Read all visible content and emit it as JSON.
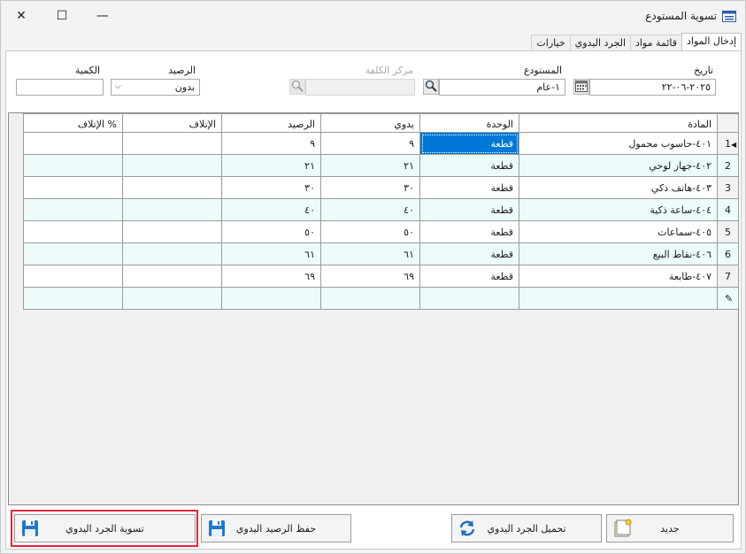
{
  "window": {
    "title": "تسوية المستودع",
    "minimize_glyph": "—",
    "maximize_glyph": "☐",
    "close_glyph": "✕"
  },
  "tabs": [
    {
      "label": "إدخال المواد",
      "active": true
    },
    {
      "label": "قائمة مواد",
      "active": false
    },
    {
      "label": "الجرد اليدوي",
      "active": false
    },
    {
      "label": "خيارات",
      "active": false
    }
  ],
  "form": {
    "date_label": "تاريخ",
    "date_value": "٢٠٢٥-٠٦-٢٢",
    "warehouse_label": "المستودع",
    "warehouse_value": "١-عام",
    "cost_center_label": "مركز الكلفة",
    "cost_center_value": "",
    "balance_label": "الرصيد",
    "balance_value": "بدون",
    "quantity_label": "الكمية",
    "quantity_value": ""
  },
  "grid": {
    "columns": [
      "المادة",
      "الوحدة",
      "يدوي",
      "الرصيد",
      "الإتلاف",
      "الإتلاف %"
    ],
    "rows": [
      {
        "num": "1",
        "item": "٤٠١-حاسوب محمول",
        "unit": "قطعة",
        "manual": "٩",
        "balance": "٩",
        "damage": "",
        "damage_pct": ""
      },
      {
        "num": "2",
        "item": "٤٠٢-جهاز لوحي",
        "unit": "قطعة",
        "manual": "٢١",
        "balance": "٢١",
        "damage": "",
        "damage_pct": ""
      },
      {
        "num": "3",
        "item": "٤٠٣-هاتف ذكي",
        "unit": "قطعة",
        "manual": "٣٠",
        "balance": "٣٠",
        "damage": "",
        "damage_pct": ""
      },
      {
        "num": "4",
        "item": "٤٠٤-ساعة ذكية",
        "unit": "قطعة",
        "manual": "٤٠",
        "balance": "٤٠",
        "damage": "",
        "damage_pct": ""
      },
      {
        "num": "5",
        "item": "٤٠٥-سماعات",
        "unit": "قطعة",
        "manual": "٥٠",
        "balance": "٥٠",
        "damage": "",
        "damage_pct": ""
      },
      {
        "num": "6",
        "item": "٤٠٦-نقاط البيع",
        "unit": "قطعة",
        "manual": "٦١",
        "balance": "٦١",
        "damage": "",
        "damage_pct": ""
      },
      {
        "num": "7",
        "item": "٤٠٧-طابعة",
        "unit": "قطعة",
        "manual": "٦٩",
        "balance": "٦٩",
        "damage": "",
        "damage_pct": ""
      }
    ],
    "new_row_marker": "✎"
  },
  "buttons": {
    "new": "جديد",
    "load_manual": "تحميل الجرد اليدوي",
    "save_balance": "حفظ الرصيد اليدوي",
    "settle_manual": "تسوية الجرد اليدوي"
  },
  "icons": {
    "title": "window-form-icon",
    "calendar": "calendar-icon",
    "search": "magnifier-icon",
    "new": "new-document-icon",
    "load": "refresh-arrows-icon",
    "save": "floppy-disk-icon"
  },
  "colors": {
    "selection": "#0078d7",
    "alt_row": "#ecfcfb",
    "highlight": "#e2263b"
  }
}
